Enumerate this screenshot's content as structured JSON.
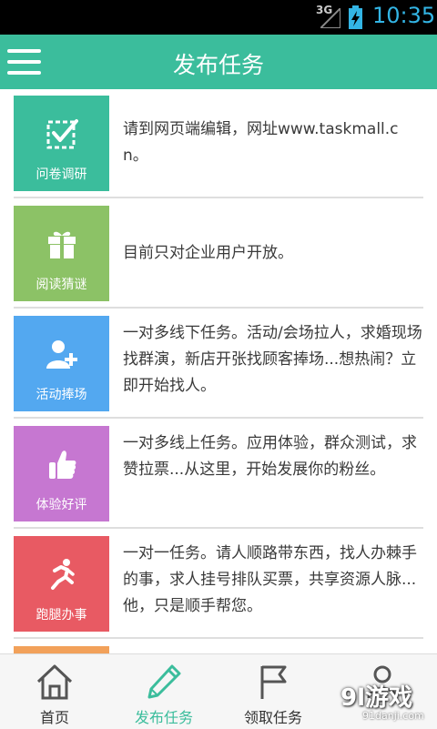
{
  "status_bar": {
    "network": "3G",
    "time": "10:35",
    "time_color": "#33b5e5"
  },
  "app_bar": {
    "title": "发布任务",
    "color": "#3bbd9c"
  },
  "tasks": [
    {
      "label": "问卷调研",
      "color": "#3bbd9c",
      "icon": "checkbox-icon",
      "desc": "请到网页端编辑，网址www.taskmall.cn。"
    },
    {
      "label": "阅读猜谜",
      "color": "#8cc266",
      "icon": "gift-icon",
      "desc": "目前只对企业用户开放。"
    },
    {
      "label": "活动捧场",
      "color": "#53a8f0",
      "icon": "add-person-icon",
      "desc": "一对多线下任务。活动/会场拉人，求婚现场找群演，新店开张找顾客捧场...想热闹？立即开始找人。"
    },
    {
      "label": "体验好评",
      "color": "#c677d1",
      "icon": "thumbs-up-icon",
      "desc": "一对多线上任务。应用体验，群众测试，求赞拉票...从这里，开始发展你的粉丝。"
    },
    {
      "label": "跑腿办事",
      "color": "#e85a63",
      "icon": "runner-icon",
      "desc": "一对一任务。请人顺路带东西，找人办棘手的事，求人挂号排队买票，共享资源人脉...他，只是顺手帮您。"
    }
  ],
  "partial_tile_color": "#f2a15a",
  "tabs": [
    {
      "label": "首页",
      "icon": "home-icon"
    },
    {
      "label": "发布任务",
      "icon": "pencil-icon",
      "active": true
    },
    {
      "label": "领取任务",
      "icon": "flag-icon"
    },
    {
      "label": "",
      "icon": "person-icon"
    }
  ],
  "watermark": {
    "main": "9l游戏",
    "sub": "91danji.com"
  }
}
